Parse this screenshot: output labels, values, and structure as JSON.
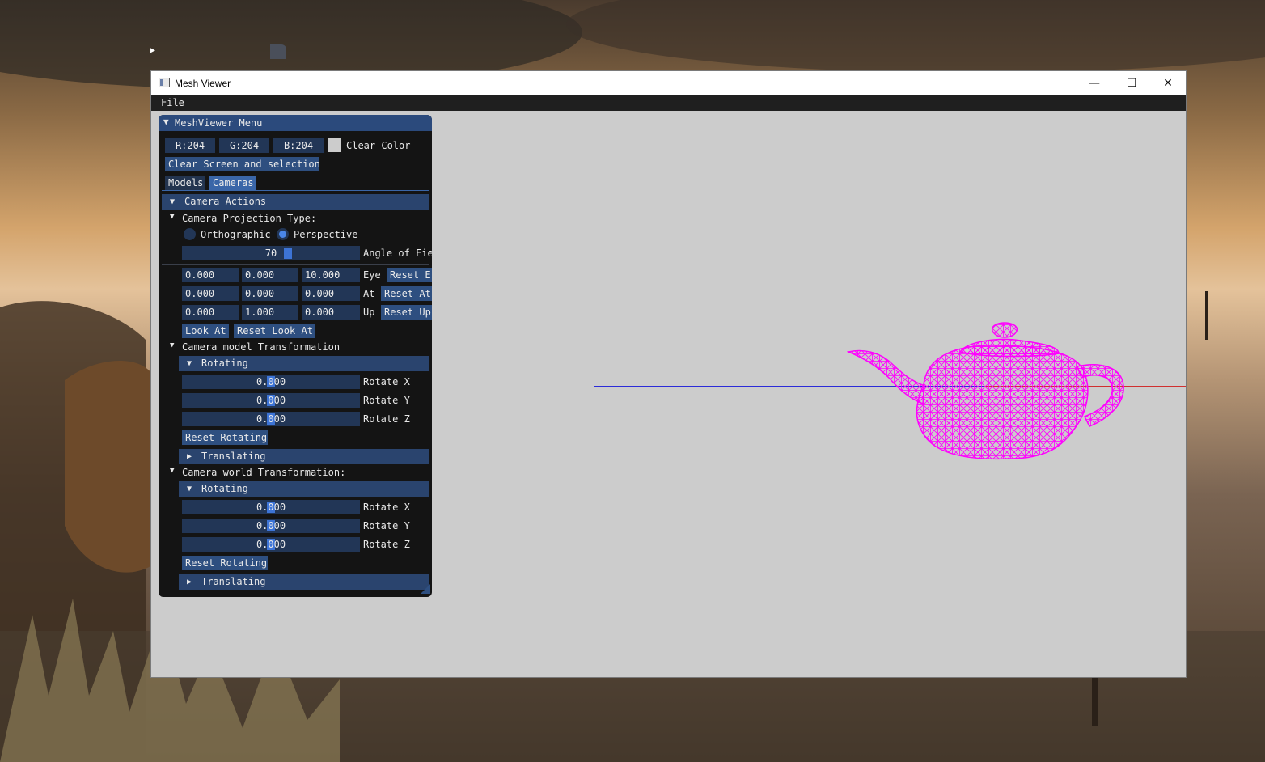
{
  "window": {
    "title": "Mesh Viewer",
    "controls": {
      "minimize": "—",
      "maximize": "☐",
      "close": "✕"
    }
  },
  "menubar": {
    "file": "File"
  },
  "panel": {
    "title": "MeshViewer Menu",
    "clear_color": {
      "r": "R:204",
      "g": "G:204",
      "b": "B:204",
      "label": "Clear Color",
      "swatch_color": "#cccccc"
    },
    "clear_screen_button": "Clear Screen and selection",
    "tabs": [
      {
        "label": "Models"
      },
      {
        "label": "Cameras"
      }
    ],
    "camera_actions": {
      "label": "Camera Actions",
      "projection": {
        "label": "Camera Projection Type:",
        "orthographic": "Orthographic",
        "perspective": "Perspective",
        "selected": "Perspective",
        "fov_value": "70",
        "fov_label": "Angle of Fie"
      },
      "eye": {
        "x": "0.000",
        "y": "0.000",
        "z": "10.000",
        "label": "Eye",
        "reset": "Reset E"
      },
      "at": {
        "x": "0.000",
        "y": "0.000",
        "z": "0.000",
        "label": "At",
        "reset": "Reset At"
      },
      "up": {
        "x": "0.000",
        "y": "1.000",
        "z": "0.000",
        "label": "Up",
        "reset": "Reset Up"
      },
      "look_at_button": "Look At",
      "reset_look_at_button": "Reset Look At"
    },
    "model_transform": {
      "label": "Camera model Transformation",
      "rotating": "Rotating",
      "rotate_x": {
        "value": "0.000",
        "label": "Rotate X"
      },
      "rotate_y": {
        "value": "0.000",
        "label": "Rotate Y"
      },
      "rotate_z": {
        "value": "0.000",
        "label": "Rotate Z"
      },
      "reset_rotating": "Reset Rotating",
      "translating": "Translating"
    },
    "world_transform": {
      "label": "Camera world Transformation:",
      "rotating": "Rotating",
      "rotate_x": {
        "value": "0.000",
        "label": "Rotate X"
      },
      "rotate_y": {
        "value": "0.000",
        "label": "Rotate Y"
      },
      "rotate_z": {
        "value": "0.000",
        "label": "Rotate Z"
      },
      "reset_rotating": "Reset Rotating",
      "translating": "Translating"
    }
  },
  "viewport": {
    "background": "#cccccc",
    "axis_colors": {
      "x": "#d03030",
      "y": "#2aa02a",
      "z": "#2b2bd8"
    },
    "mesh": {
      "name": "teapot-wireframe",
      "color": "#ff00ff"
    }
  }
}
